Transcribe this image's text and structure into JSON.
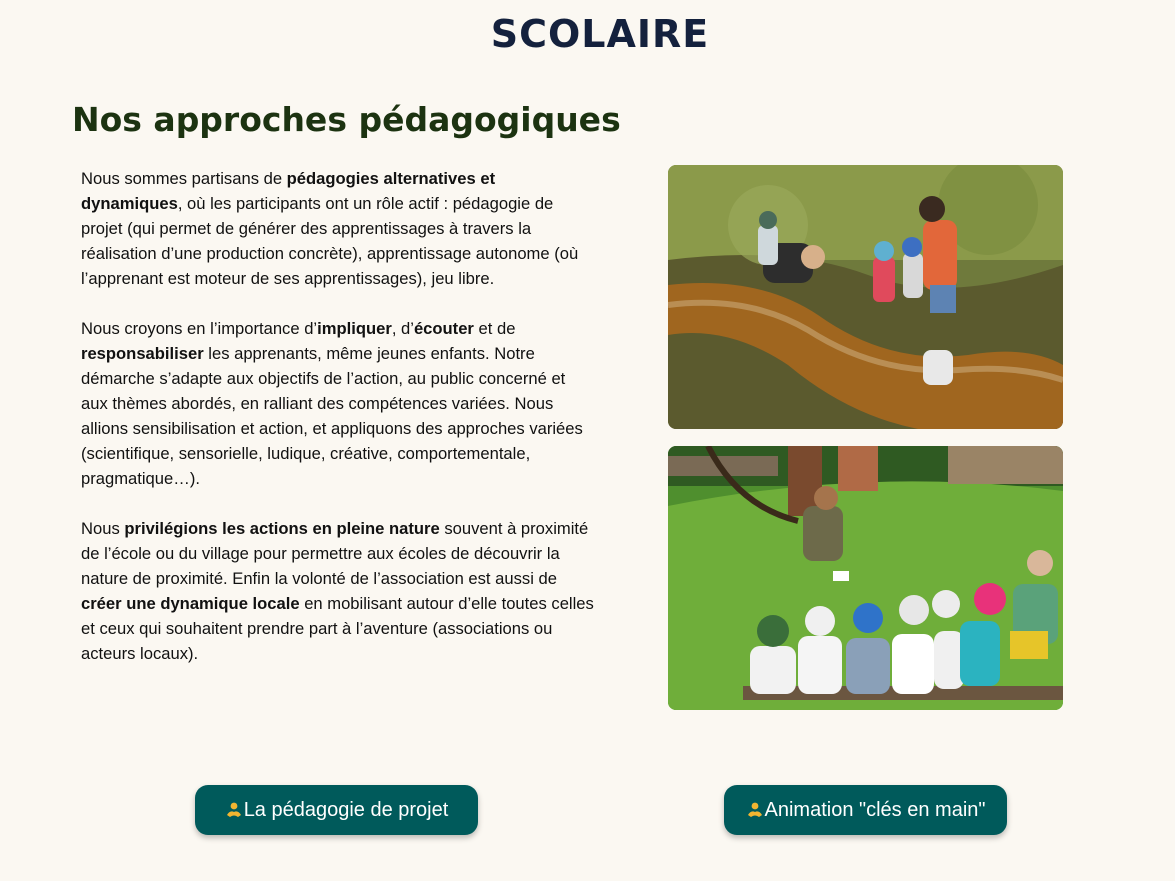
{
  "header": {
    "title": "SCOLAIRE"
  },
  "section": {
    "title": "Nos approches pédagogiques",
    "p1": {
      "a": "Nous sommes partisans de ",
      "b": "pédagogies alternatives et dynamiques",
      "c": ", où les participants ont un rôle actif : pédagogie de projet (qui permet de générer des apprentissages à travers la réalisation d’une production concrète), apprentissage autonome (où l’apprenant est moteur de ses apprentissages), jeu libre."
    },
    "p2": {
      "a": "Nous croyons en l’importance d’",
      "b": "impliquer",
      "c": ", d’",
      "d": "écouter",
      "e": " et de ",
      "f": "responsabiliser",
      "g": " les apprenants, même jeunes enfants. Notre démarche s’adapte aux objectifs de l’action, au public concerné et aux thèmes abordés, en ralliant des compétences variées. Nous allions sensibilisation et action, et appliquons des approches variées (scientifique, sensorielle, ludique, créative, comportementale, pragmatique…)."
    },
    "p3": {
      "a": "Nous ",
      "b": "privilégions les actions en pleine nature",
      "c": " souvent à proximité de l’école ou du village pour permettre aux écoles de découvrir la nature de proximité. Enfin la volonté de l’association est aussi de ",
      "d": "créer une dynamique locale",
      "e": " en mobilisant autour d’elle toutes celles et ceux qui souhaitent prendre part à l’aventure (associations ou acteurs locaux)."
    }
  },
  "photos": {
    "photo1_icon": "children-in-stream-photo",
    "photo2_icon": "children-on-bench-photo"
  },
  "buttons": {
    "project_label": "La pédagogie de projet",
    "animation_label": "Animation \"clés en main\"",
    "icon": "person-hands-icon",
    "bg_color": "#005a5b",
    "icon_color": "#f2b531"
  }
}
